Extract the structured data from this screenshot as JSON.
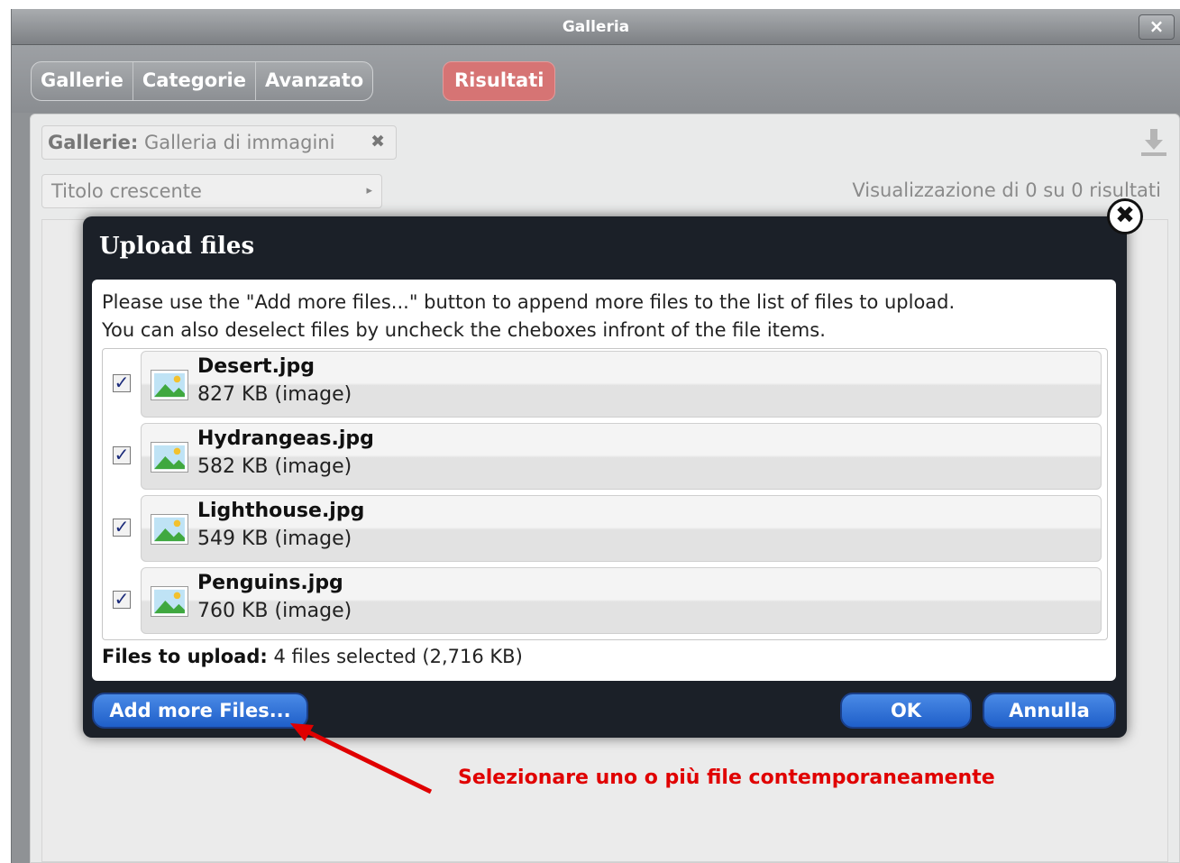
{
  "window": {
    "title": "Galleria",
    "close_label": "×"
  },
  "toolbar": {
    "tabs": [
      "Gallerie",
      "Categorie",
      "Avanzato"
    ],
    "results_button": "Risultati"
  },
  "filter": {
    "label": "Gallerie:",
    "value": "Galleria di immagini",
    "remove_icon": "✖"
  },
  "sort": {
    "value": "Titolo crescente",
    "arrow": "▸"
  },
  "results_text": "Visualizzazione di 0 su 0 risultati",
  "dialog": {
    "title": "Upload files",
    "close_label": "✖",
    "intro_line1": "Please use the \"Add more files...\" button to append more files to the list of files to upload.",
    "intro_line2": "You can also deselect files by uncheck the cheboxes infront of the file items.",
    "files": [
      {
        "name": "Desert.jpg",
        "meta": "827 KB (image)",
        "checked": true
      },
      {
        "name": "Hydrangeas.jpg",
        "meta": "582 KB (image)",
        "checked": true
      },
      {
        "name": "Lighthouse.jpg",
        "meta": "549 KB (image)",
        "checked": true
      },
      {
        "name": "Penguins.jpg",
        "meta": "760 KB (image)",
        "checked": true
      }
    ],
    "summary_label": "Files to upload:",
    "summary_value": "4 files selected (2,716 KB)",
    "add_button": "Add more Files...",
    "ok_button": "OK",
    "cancel_button": "Annulla"
  },
  "annotation": {
    "text": "Selezionare uno o più file contemporaneamente",
    "color": "#e00000"
  },
  "colors": {
    "dialog_bg": "#1b2028",
    "button_blue": "#2f70d8",
    "results_red": "#d67474"
  }
}
